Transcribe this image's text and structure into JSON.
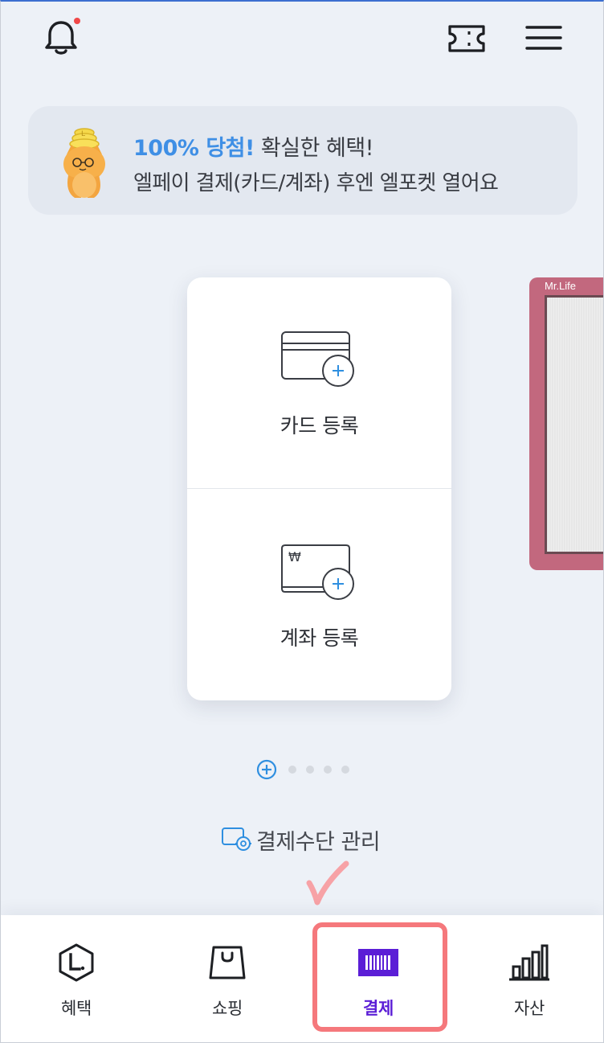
{
  "promo": {
    "highlight": "100% 당첨!",
    "line1_rest": " 확실한 혜택!",
    "line2": "엘페이 결제(카드/계좌) 후엔 엘포켓 열어요"
  },
  "payment_methods": {
    "card_register": "카드 등록",
    "account_register": "계좌 등록",
    "account_currency_symbol": "₩"
  },
  "peek_card": {
    "brand": "Mr.Life"
  },
  "manage": {
    "label": "결제수단 관리"
  },
  "bottom_nav": {
    "items": [
      {
        "label": "혜택",
        "icon": "lpoint-benefit-icon"
      },
      {
        "label": "쇼핑",
        "icon": "shopping-bag-icon"
      },
      {
        "label": "결제",
        "icon": "barcode-pay-icon"
      },
      {
        "label": "자산",
        "icon": "bar-chart-asset-icon"
      }
    ],
    "active_index": 2
  },
  "colors": {
    "accent_blue": "#3f8fe5",
    "nav_active_purple": "#5b1ed6",
    "annotation_red": "#f5787c",
    "peek_card_pink": "#c2687e"
  }
}
